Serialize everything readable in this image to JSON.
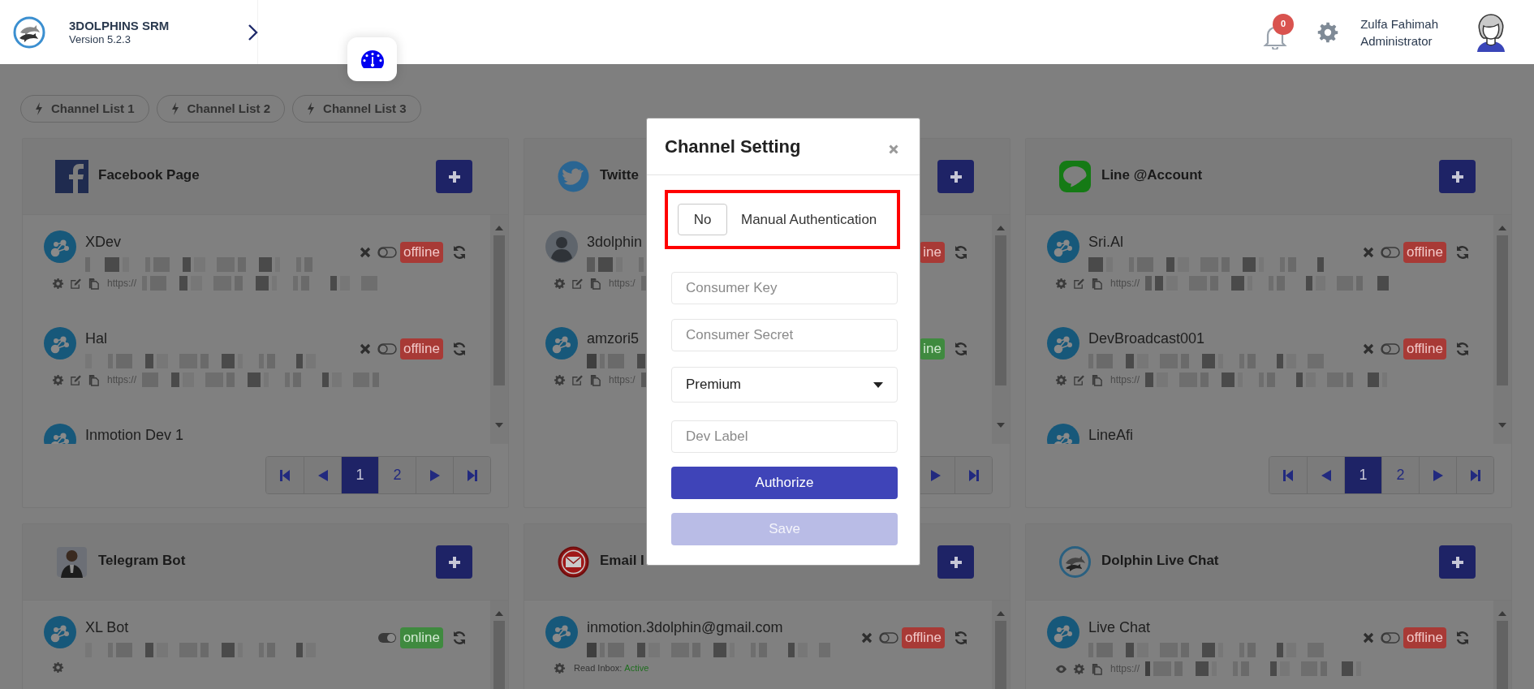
{
  "app": {
    "name": "3DOLPHINS SRM",
    "version": "Version 5.2.3"
  },
  "notifications": {
    "count": "0"
  },
  "user": {
    "name": "Zulfa Fahimah",
    "role": "Administrator"
  },
  "tabs": [
    {
      "label": "Channel List 1"
    },
    {
      "label": "Channel List 2"
    },
    {
      "label": "Channel List 3"
    }
  ],
  "cards": [
    {
      "kind": "facebook",
      "title": "Facebook Page",
      "rows": [
        {
          "name": "XDev",
          "avatar": {
            "kind": "network"
          },
          "removable": true,
          "enabled": false,
          "status": "offline",
          "online": false,
          "tools": [
            {
              "kind": "gear"
            },
            {
              "kind": "edit"
            },
            {
              "kind": "copy"
            }
          ],
          "url": "https://"
        },
        {
          "name": "Hal",
          "avatar": {
            "kind": "network"
          },
          "removable": true,
          "enabled": false,
          "status": "offline",
          "online": false,
          "tools": [
            {
              "kind": "gear"
            },
            {
              "kind": "edit"
            },
            {
              "kind": "copy"
            }
          ],
          "url": "https://"
        },
        {
          "name": "Inmotion Dev 1",
          "avatar": {
            "kind": "network"
          }
        }
      ],
      "pagination": [
        {
          "kind": "first"
        },
        {
          "kind": "prev"
        },
        {
          "kind": "page",
          "label": "1",
          "selected": true
        },
        {
          "kind": "page",
          "label": "2",
          "selected": false
        },
        {
          "kind": "next"
        },
        {
          "kind": "last"
        }
      ]
    },
    {
      "kind": "twitter",
      "title": "Twitte",
      "rows": [
        {
          "name": "3dolphin",
          "avatar": {
            "kind": "person"
          },
          "status": "ine",
          "online": false,
          "tools": [
            {
              "kind": "gear"
            },
            {
              "kind": "edit"
            },
            {
              "kind": "copy"
            }
          ],
          "url": "https:/"
        },
        {
          "name": "amzori5",
          "avatar": {
            "kind": "network"
          },
          "status": "ine",
          "online": true,
          "tools": [
            {
              "kind": "gear"
            },
            {
              "kind": "edit"
            },
            {
              "kind": "copy"
            }
          ],
          "url": "https:/"
        }
      ],
      "pagination": [
        {
          "kind": "next"
        },
        {
          "kind": "last"
        }
      ]
    },
    {
      "kind": "line",
      "title": "Line @Account",
      "rows": [
        {
          "name": "Sri.Al",
          "avatar": {
            "kind": "network"
          },
          "removable": true,
          "enabled": false,
          "status": "offline",
          "online": false,
          "tools": [
            {
              "kind": "gear"
            },
            {
              "kind": "edit"
            },
            {
              "kind": "copy"
            }
          ],
          "url": "https://"
        },
        {
          "name": "DevBroadcast001",
          "avatar": {
            "kind": "network"
          },
          "removable": true,
          "enabled": false,
          "status": "offline",
          "online": false,
          "tools": [
            {
              "kind": "gear"
            },
            {
              "kind": "edit"
            },
            {
              "kind": "copy"
            }
          ],
          "url": "https://"
        },
        {
          "name": "LineAfi",
          "avatar": {
            "kind": "network"
          }
        }
      ],
      "pagination": [
        {
          "kind": "first"
        },
        {
          "kind": "prev"
        },
        {
          "kind": "page",
          "label": "1",
          "selected": true
        },
        {
          "kind": "page",
          "label": "2",
          "selected": false
        },
        {
          "kind": "next"
        },
        {
          "kind": "last"
        }
      ]
    },
    {
      "kind": "telegram",
      "title": "Telegram Bot",
      "rows": [
        {
          "name": "XL Bot",
          "avatar": {
            "kind": "network"
          },
          "removable": false,
          "enabled": true,
          "status": "online",
          "online": true,
          "tools": [
            {
              "kind": "gear"
            }
          ]
        }
      ]
    },
    {
      "kind": "email",
      "title": "Email I",
      "rows": [
        {
          "name": "inmotion.3dolphin@gmail.com",
          "avatar": {
            "kind": "network"
          },
          "removable": true,
          "enabled": false,
          "status": "offline",
          "online": false,
          "tools": [
            {
              "kind": "gear"
            }
          ],
          "note": "Read Inbox:",
          "note_value": "Active"
        }
      ]
    },
    {
      "kind": "dolphin",
      "title": "Dolphin Live Chat",
      "rows": [
        {
          "name": "Live Chat",
          "avatar": {
            "kind": "network"
          },
          "removable": true,
          "enabled": false,
          "status": "offline",
          "online": false,
          "tools": [
            {
              "kind": "eye"
            },
            {
              "kind": "gear"
            },
            {
              "kind": "copy"
            }
          ],
          "url": "https://"
        }
      ]
    }
  ],
  "modal": {
    "title": "Channel Setting",
    "manual_auth": {
      "toggle": "No",
      "label": "Manual Authentication",
      "highlighted": true
    },
    "fields": [
      {
        "kind": "text",
        "placeholder": "Consumer Key"
      },
      {
        "kind": "text",
        "placeholder": "Consumer Secret"
      },
      {
        "kind": "select",
        "value": "Premium"
      },
      {
        "kind": "text",
        "placeholder": "Dev Label"
      }
    ],
    "buttons": [
      {
        "label": "Authorize",
        "disabled": false
      },
      {
        "label": "Save",
        "disabled": true
      }
    ]
  }
}
